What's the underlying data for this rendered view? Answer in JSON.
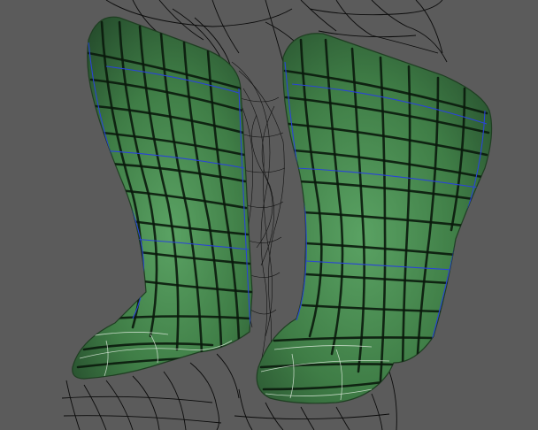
{
  "viewport": {
    "background_color": "#5b5b5b",
    "wireframe_color": "#0b0b0b",
    "mesh_fill_color": "#3e7a44",
    "mesh_highlight_color": "#58a060",
    "mesh_grid_color": "#0a1a0c",
    "edge_highlight_color": "#2a43d8"
  },
  "scene": {
    "objects": [
      {
        "name": "left-boot"
      },
      {
        "name": "right-boot"
      },
      {
        "name": "background-wireframe"
      }
    ]
  }
}
